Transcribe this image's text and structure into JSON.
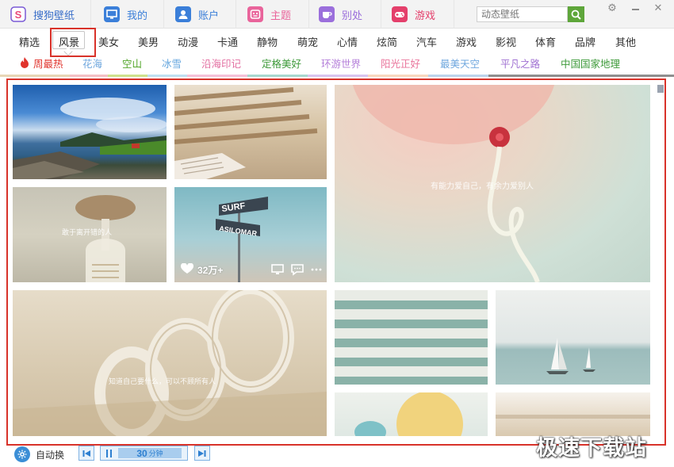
{
  "app": {
    "name": "搜狗壁纸"
  },
  "nav": {
    "tabs": [
      {
        "label": "我的",
        "icon": "monitor-icon",
        "color": "#3b7fd9"
      },
      {
        "label": "账户",
        "icon": "user-icon",
        "color": "#3b7fd9"
      },
      {
        "label": "主题",
        "icon": "theme-icon",
        "color": "#e9649b"
      },
      {
        "label": "别处",
        "icon": "coffee-icon",
        "color": "#9b6fdc"
      },
      {
        "label": "游戏",
        "icon": "gamepad-icon",
        "color": "#e43f6b"
      }
    ],
    "search_placeholder": "动态壁纸",
    "accent_green": "#5ea63a"
  },
  "categories": [
    "精选",
    "风景",
    "美女",
    "美男",
    "动漫",
    "卡通",
    "静物",
    "萌宠",
    "心情",
    "炫简",
    "汽车",
    "游戏",
    "影视",
    "体育",
    "品牌",
    "其他"
  ],
  "active_category": "风景",
  "topics": [
    {
      "label": "周最热",
      "color": "#e0332c",
      "bar": "#e7d6b6",
      "hot": true
    },
    {
      "label": "花海",
      "color": "#6fa7de",
      "bar": "#f3c1c5"
    },
    {
      "label": "空山",
      "color": "#52a62a",
      "bar": "#cfe28e"
    },
    {
      "label": "冰雪",
      "color": "#64a6de",
      "bar": "#bfe0f2"
    },
    {
      "label": "沿海印记",
      "color": "#e36fa1",
      "bar": "#f4c2d9"
    },
    {
      "label": "定格美好",
      "color": "#3e9a3a",
      "bar": "#a8d8d0"
    },
    {
      "label": "环游世界",
      "color": "#b47ed9",
      "bar": "#d8c5ef"
    },
    {
      "label": "阳光正好",
      "color": "#e9749b",
      "bar": "#f8d8c0"
    },
    {
      "label": "最美天空",
      "color": "#6fa7de",
      "bar": "#bcd4ec"
    },
    {
      "label": "平凡之路",
      "color": "#9f6fd2",
      "bar": "#8f8f8f"
    },
    {
      "label": "中国国家地理",
      "color": "#3e9a3a",
      "bar": "#8f8f8f"
    }
  ],
  "wallpapers": {
    "balloon_caption": "有能力爱自己，有余力爱别人",
    "bicycle_caption": "敢于离开错的人",
    "rope_caption": "知道自己要什么，可以不顾所有人",
    "sign_line1": "SURF",
    "sign_line2": "ASILOMAR",
    "likes": "32万+"
  },
  "bottom": {
    "auto_change": "自动换",
    "interval": "30",
    "interval_unit": "分钟"
  },
  "watermark": "极速下载站"
}
